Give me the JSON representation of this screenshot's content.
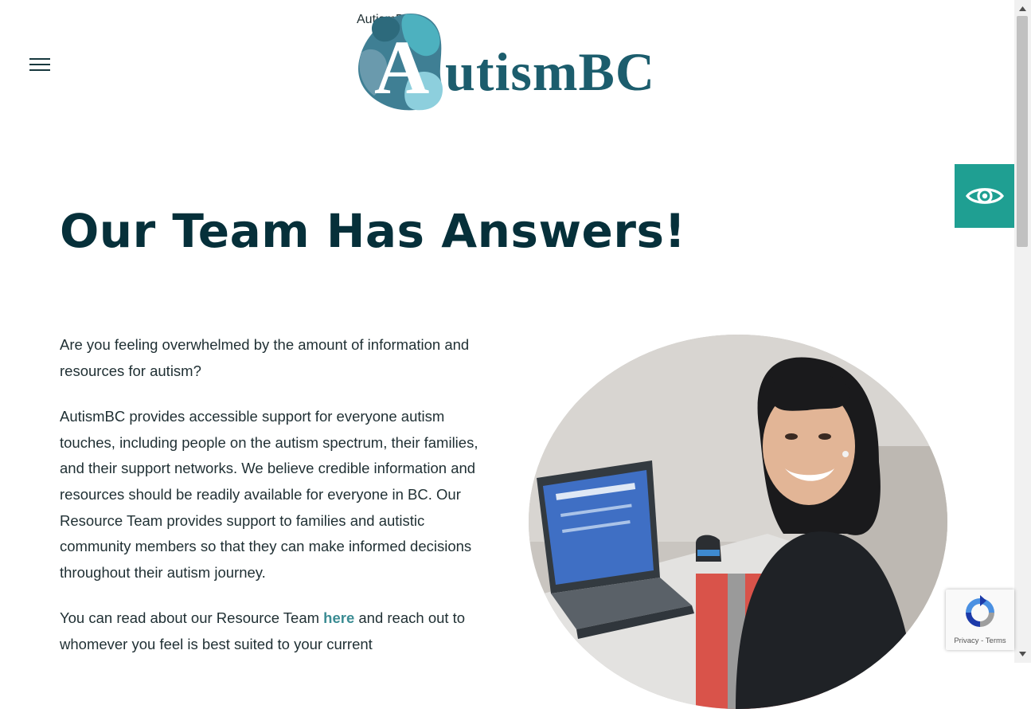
{
  "header": {
    "menu_icon": "hamburger-menu-icon",
    "logo_text": "AutismBC",
    "logo_text_rest": "utismBC"
  },
  "accessibility": {
    "icon": "eye-icon",
    "color": "#1f9f92"
  },
  "main": {
    "title": "Our Team Has Answers!",
    "paragraphs": [
      "Are you feeling overwhelmed by the amount of information and resources for autism?",
      "AutismBC provides accessible support for everyone autism touches, including people on the autism spectrum, their families, and their support networks. We believe credible information and resources should be readily available for everyone in BC. Our Resource Team provides support to families and autistic community members so that they can make informed decisions throughout their autism journey."
    ],
    "p3_before": "You can read about our Resource Team ",
    "p3_link": "here",
    "p3_after": " and reach out to whomever you feel is best suited to your current"
  },
  "recaptcha": {
    "privacy": "Privacy",
    "separator": " - ",
    "terms": "Terms"
  },
  "colors": {
    "title": "#06303a",
    "link": "#3b8c93",
    "brand": "#1c5d6d"
  }
}
